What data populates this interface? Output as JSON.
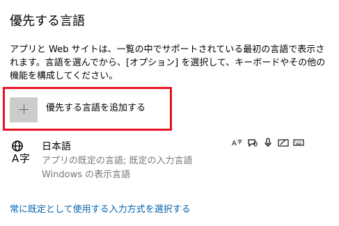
{
  "page": {
    "title": "優先する言語",
    "description": "アプリと Web サイトは、一覧の中でサポートされている最初の言語で表示されます。言語を選んでから、[オプション] を選択して、キーボードやその他の機能を構成してください。"
  },
  "add_language": {
    "label": "優先する言語を追加する",
    "icon": "plus-icon"
  },
  "languages": [
    {
      "name": "日本語",
      "line1": "アプリの既定の言語; 既定の入力言語",
      "line2": "Windows の表示言語",
      "icon": "language-icon",
      "capabilities": [
        "text-to-speech-icon",
        "speech-recognition-icon",
        "microphone-icon",
        "handwriting-icon",
        "keyboard-icon"
      ]
    }
  ],
  "link": {
    "label": "常に既定として使用する入力方式を選択する"
  },
  "colors": {
    "highlight_border": "#e81123",
    "link": "#0063b1",
    "plus_bg": "#cccccc",
    "secondary_text": "#777777"
  }
}
